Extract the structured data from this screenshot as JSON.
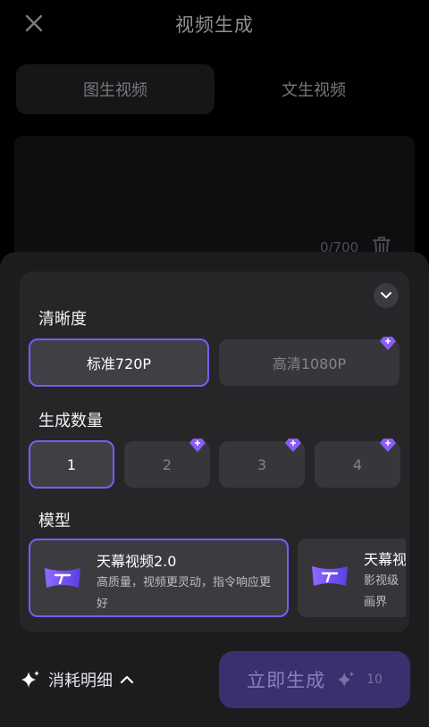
{
  "header": {
    "title": "视频生成",
    "close_icon": "close-icon"
  },
  "tabs": [
    {
      "label": "图生视频"
    },
    {
      "label": "文生视频"
    }
  ],
  "prompt": {
    "counter": "0/700"
  },
  "settings": {
    "resolution": {
      "label": "清晰度",
      "options": [
        {
          "label": "标准720P",
          "selected": true
        },
        {
          "label": "高清1080P",
          "premium": true
        }
      ]
    },
    "count": {
      "label": "生成数量",
      "options": [
        {
          "label": "1",
          "selected": true
        },
        {
          "label": "2",
          "premium": true
        },
        {
          "label": "3",
          "premium": true
        },
        {
          "label": "4",
          "premium": true
        }
      ]
    },
    "model": {
      "label": "模型",
      "cards": [
        {
          "name": "天幕视频2.0",
          "desc": "高质量，视频更灵动，指令响应更好",
          "selected": true
        },
        {
          "name": "天幕视",
          "desc": "影视级画界"
        }
      ]
    }
  },
  "footer": {
    "cost_label": "消耗明细",
    "generate_label": "立即生成",
    "generate_cost": "10"
  },
  "colors": {
    "accent": "#7b5cf5",
    "button_bg": "#3c2f6e",
    "sheet_bg": "#1c1c1f"
  }
}
